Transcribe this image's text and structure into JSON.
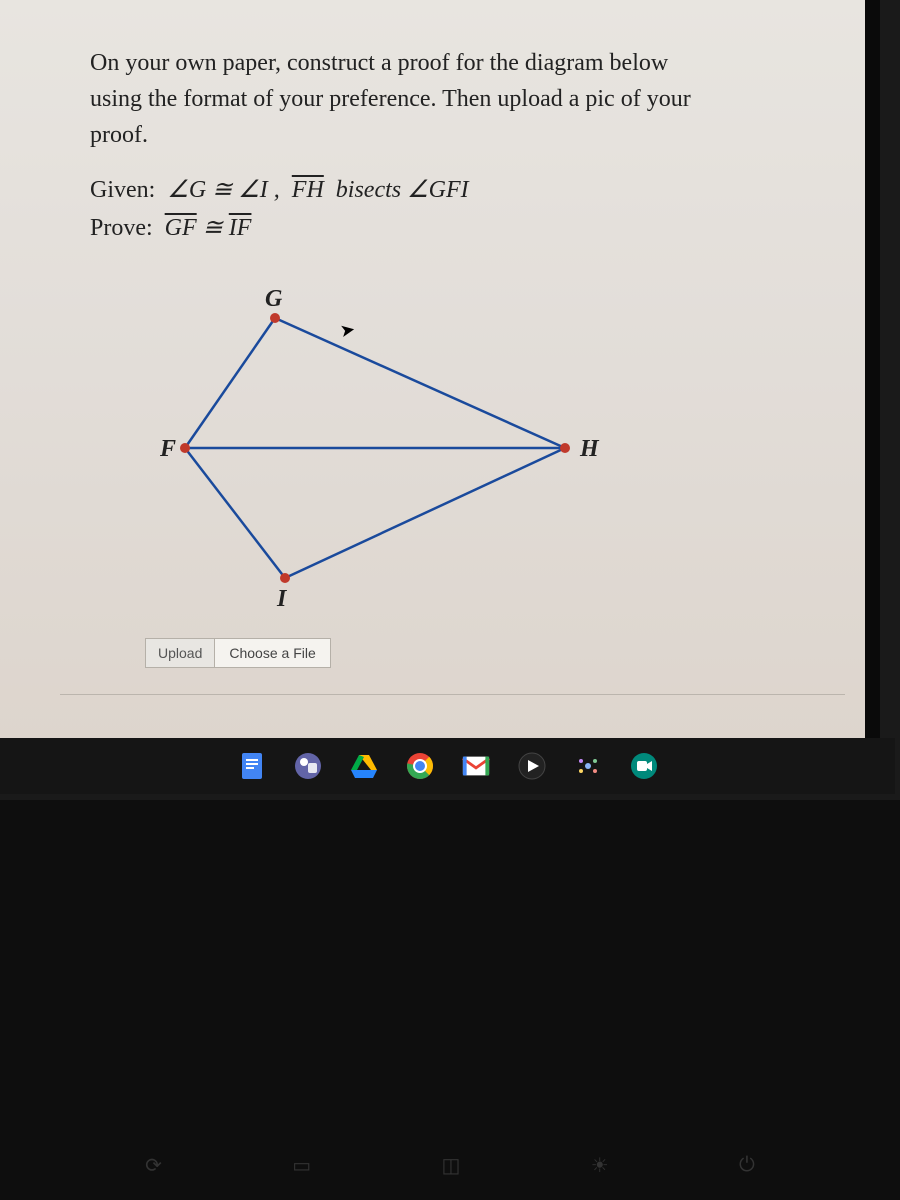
{
  "problem": {
    "instructions_line1": "On your own paper, construct a proof for the diagram below",
    "instructions_line2": "using the format of your preference. Then upload a pic of your",
    "instructions_line3": "proof.",
    "given_label": "Given:",
    "given_part1": "∠G ≅ ∠I ,",
    "given_seg": "FH",
    "given_part2": "bisects ∠GFI",
    "prove_label": "Prove:",
    "prove_seg1": "GF",
    "prove_congr": "≅",
    "prove_seg2": "IF"
  },
  "diagram": {
    "vertices": {
      "G": "G",
      "F": "F",
      "I": "I",
      "H": "H"
    }
  },
  "upload": {
    "label": "Upload",
    "button": "Choose a File"
  },
  "taskbar_icons": [
    {
      "name": "docs-icon",
      "color": "#4285f4"
    },
    {
      "name": "teams-icon",
      "color": "#6264a7"
    },
    {
      "name": "drive-icon",
      "color": "#0f9d58"
    },
    {
      "name": "chrome-icon",
      "color": "#ea4335"
    },
    {
      "name": "gmail-icon",
      "color": "#ea4335"
    },
    {
      "name": "play-icon",
      "color": "#1db954"
    },
    {
      "name": "ai-icon",
      "color": "#8ab4f8"
    },
    {
      "name": "meet-icon",
      "color": "#00897b"
    }
  ]
}
